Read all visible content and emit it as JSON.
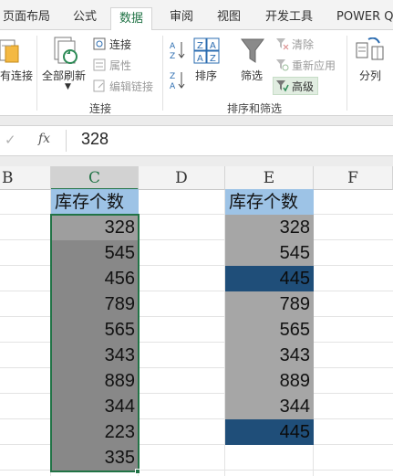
{
  "ribbon_tabs": [
    "页面布局",
    "公式",
    "数据",
    "审阅",
    "视图",
    "开发工具",
    "POWER Q"
  ],
  "ribbon": {
    "existing_connections": "有连接",
    "refresh_all": "全部刷新",
    "connections": "连接",
    "properties": "属性",
    "edit_links": "编辑链接",
    "group_connections": "连接",
    "sort": "排序",
    "filter": "筛选",
    "clear": "清除",
    "reapply": "重新应用",
    "advanced": "高级",
    "group_sort_filter": "排序和筛选",
    "text_to_columns": "分列",
    "sort_az": "A Z",
    "sort_za": "Z A"
  },
  "formula_bar": {
    "fx": "fx",
    "value": "328"
  },
  "columns": [
    "B",
    "C",
    "D",
    "E",
    "F"
  ],
  "sheet": {
    "header_c": "库存个数",
    "header_e": "库存个数",
    "column_c": [
      "328",
      "545",
      "456",
      "789",
      "565",
      "343",
      "889",
      "344",
      "223",
      "335"
    ],
    "column_e": [
      "328",
      "545",
      "445",
      "789",
      "565",
      "343",
      "889",
      "344",
      "445"
    ]
  },
  "colors": {
    "accent": "#217346",
    "header_fill": "#9dc3e6",
    "selection_fill": "#888888",
    "duplicate_fill": "#1f4e79",
    "normal_fill": "#a6a6a6"
  }
}
